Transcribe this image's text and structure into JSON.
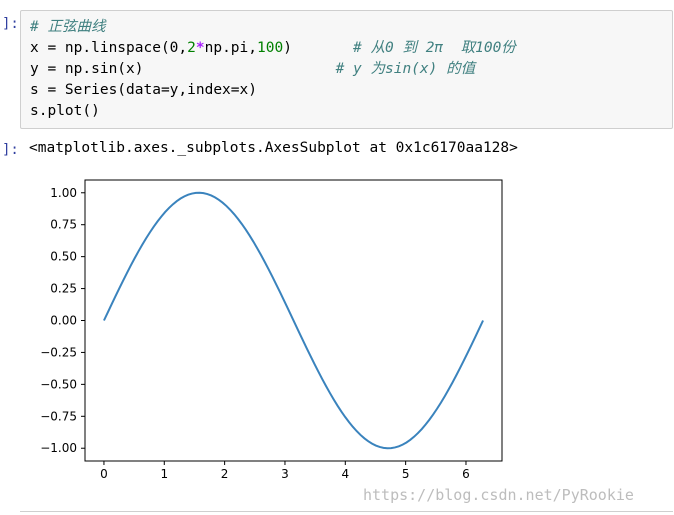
{
  "input_prompt": "]:",
  "output_prompt": "]:",
  "code_lines": {
    "l1_comment": "# 正弦曲线",
    "l2_a": "x = np.linspace(0,",
    "l2_num2": "2",
    "l2_op": "*",
    "l2_b": "np.pi,",
    "l2_num100": "100",
    "l2_c": ")",
    "l2_comment": "# 从0 到 2π  取100份",
    "l3_code": "y = np.sin(x)",
    "l3_comment": "# y 为sin(x) 的值",
    "l4_code": "s = Series(data=y,index=x)",
    "l5_code": "s.plot()"
  },
  "output_text": "<matplotlib.axes._subplots.AxesSubplot at 0x1c6170aa128>",
  "watermark": "https://blog.csdn.net/PyRookie",
  "chart_data": {
    "type": "line",
    "function": "sin(x)",
    "x_range": [
      0,
      6.283185307
    ],
    "n_points": 100,
    "xlim": [
      -0.314,
      6.597
    ],
    "ylim": [
      -1.1,
      1.1
    ],
    "x_ticks": [
      0,
      1,
      2,
      3,
      4,
      5,
      6
    ],
    "x_tick_labels": [
      "0",
      "1",
      "2",
      "3",
      "4",
      "5",
      "6"
    ],
    "y_ticks": [
      1.0,
      0.75,
      0.5,
      0.25,
      0.0,
      -0.25,
      -0.5,
      -0.75,
      -1.0
    ],
    "y_tick_labels": [
      "1.00",
      "0.75",
      "0.50",
      "0.25",
      "0.00",
      "−0.25",
      "−0.50",
      "−0.75",
      "−1.00"
    ],
    "line_color": "#3a83bd",
    "grid": false,
    "legend": false
  }
}
